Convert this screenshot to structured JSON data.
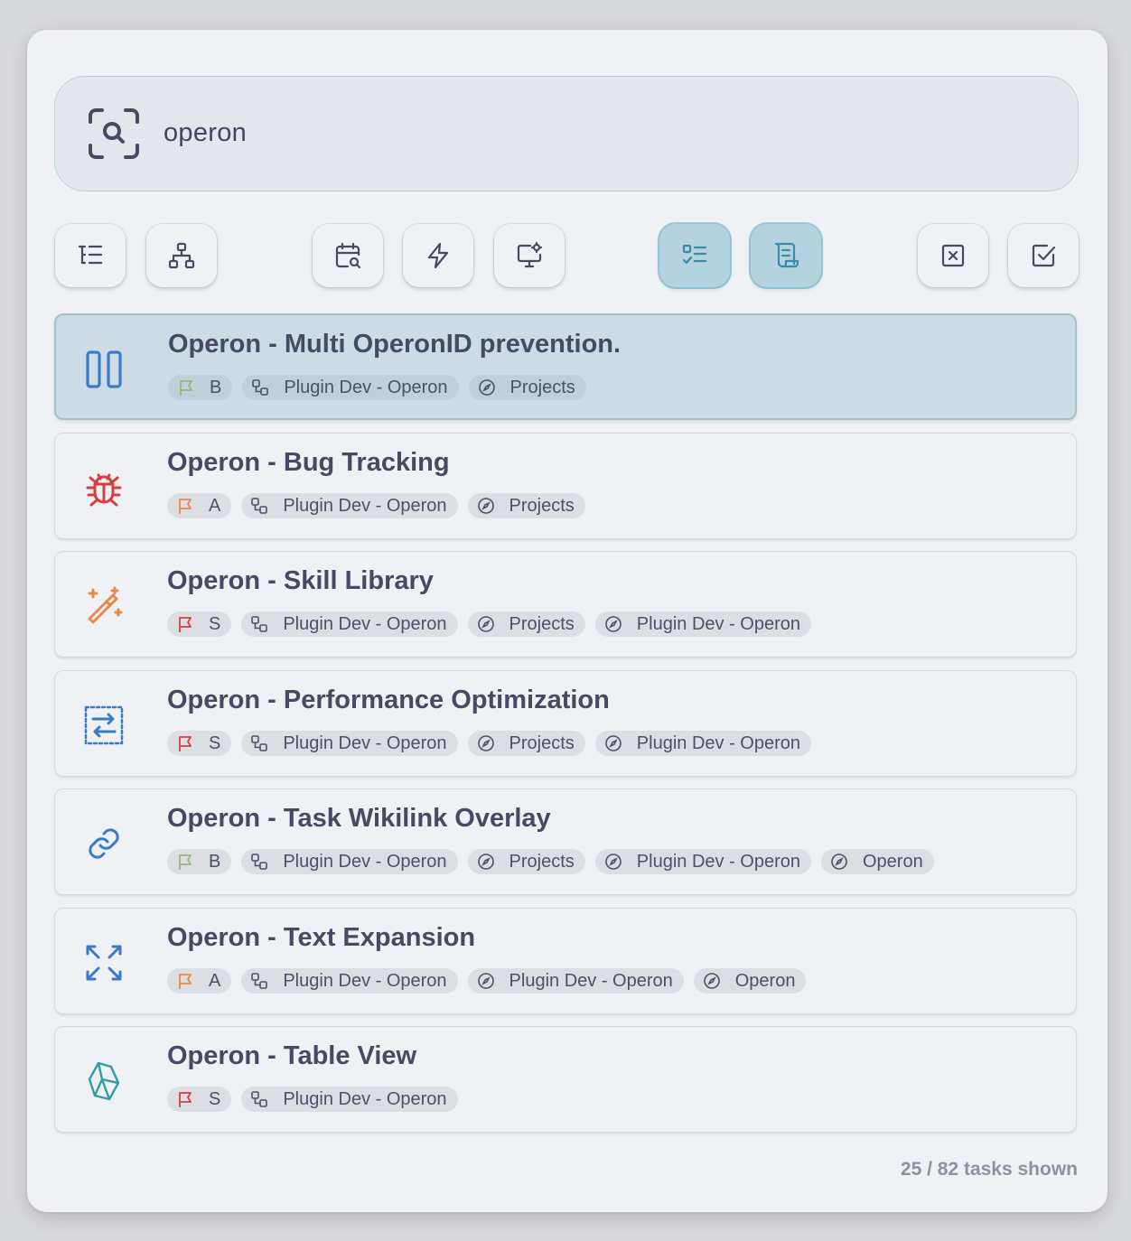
{
  "search": {
    "query": "operon",
    "icon": "scan-search-icon"
  },
  "toolbar": {
    "buttons": [
      {
        "name": "list-tree",
        "icon": "list-tree-icon",
        "active": false
      },
      {
        "name": "hierarchy",
        "icon": "network-icon",
        "active": false
      },
      {
        "name": "calendar-search",
        "icon": "calendar-search-icon",
        "active": false
      },
      {
        "name": "zap",
        "icon": "zap-icon",
        "active": false
      },
      {
        "name": "monitor-cog",
        "icon": "monitor-cog-icon",
        "active": false
      },
      {
        "name": "list-todo",
        "icon": "list-todo-icon",
        "active": true
      },
      {
        "name": "scroll-text",
        "icon": "scroll-text-icon",
        "active": true
      },
      {
        "name": "close-square",
        "icon": "square-x-icon",
        "active": false
      },
      {
        "name": "check-square",
        "icon": "square-check-icon",
        "active": false
      }
    ]
  },
  "colors": {
    "prio_B": "#9ab873",
    "prio_A": "#e8894a",
    "prio_S": "#d63f3f",
    "accent": "#3a7bc8"
  },
  "tasks": [
    {
      "title": "Operon - Multi OperonID prevention.",
      "icon": "columns-icon",
      "selected": true,
      "priority": "B",
      "tags": [
        "Plugin Dev - Operon"
      ],
      "areas": [
        "Projects"
      ]
    },
    {
      "title": "Operon - Bug Tracking",
      "icon": "bug-icon",
      "selected": false,
      "priority": "A",
      "tags": [
        "Plugin Dev - Operon"
      ],
      "areas": [
        "Projects"
      ]
    },
    {
      "title": "Operon - Skill Library",
      "icon": "wand-sparkles-icon",
      "selected": false,
      "priority": "S",
      "tags": [
        "Plugin Dev - Operon"
      ],
      "areas": [
        "Projects",
        "Plugin Dev - Operon"
      ]
    },
    {
      "title": "Operon - Performance Optimization",
      "icon": "arrow-exchange-icon",
      "selected": false,
      "priority": "S",
      "tags": [
        "Plugin Dev - Operon"
      ],
      "areas": [
        "Projects",
        "Plugin Dev - Operon"
      ]
    },
    {
      "title": "Operon - Task Wikilink Overlay",
      "icon": "link-icon",
      "selected": false,
      "priority": "B",
      "tags": [
        "Plugin Dev - Operon"
      ],
      "areas": [
        "Projects",
        "Plugin Dev - Operon",
        "Operon"
      ]
    },
    {
      "title": "Operon - Text Expansion",
      "icon": "expand-icon",
      "selected": false,
      "priority": "A",
      "tags": [
        "Plugin Dev - Operon"
      ],
      "areas": [
        "Plugin Dev - Operon",
        "Operon"
      ]
    },
    {
      "title": "Operon - Table View",
      "icon": "gem-icon",
      "selected": false,
      "priority": "S",
      "tags": [
        "Plugin Dev - Operon"
      ],
      "areas": []
    }
  ],
  "footer": {
    "count_text": "25 / 82 tasks shown"
  }
}
